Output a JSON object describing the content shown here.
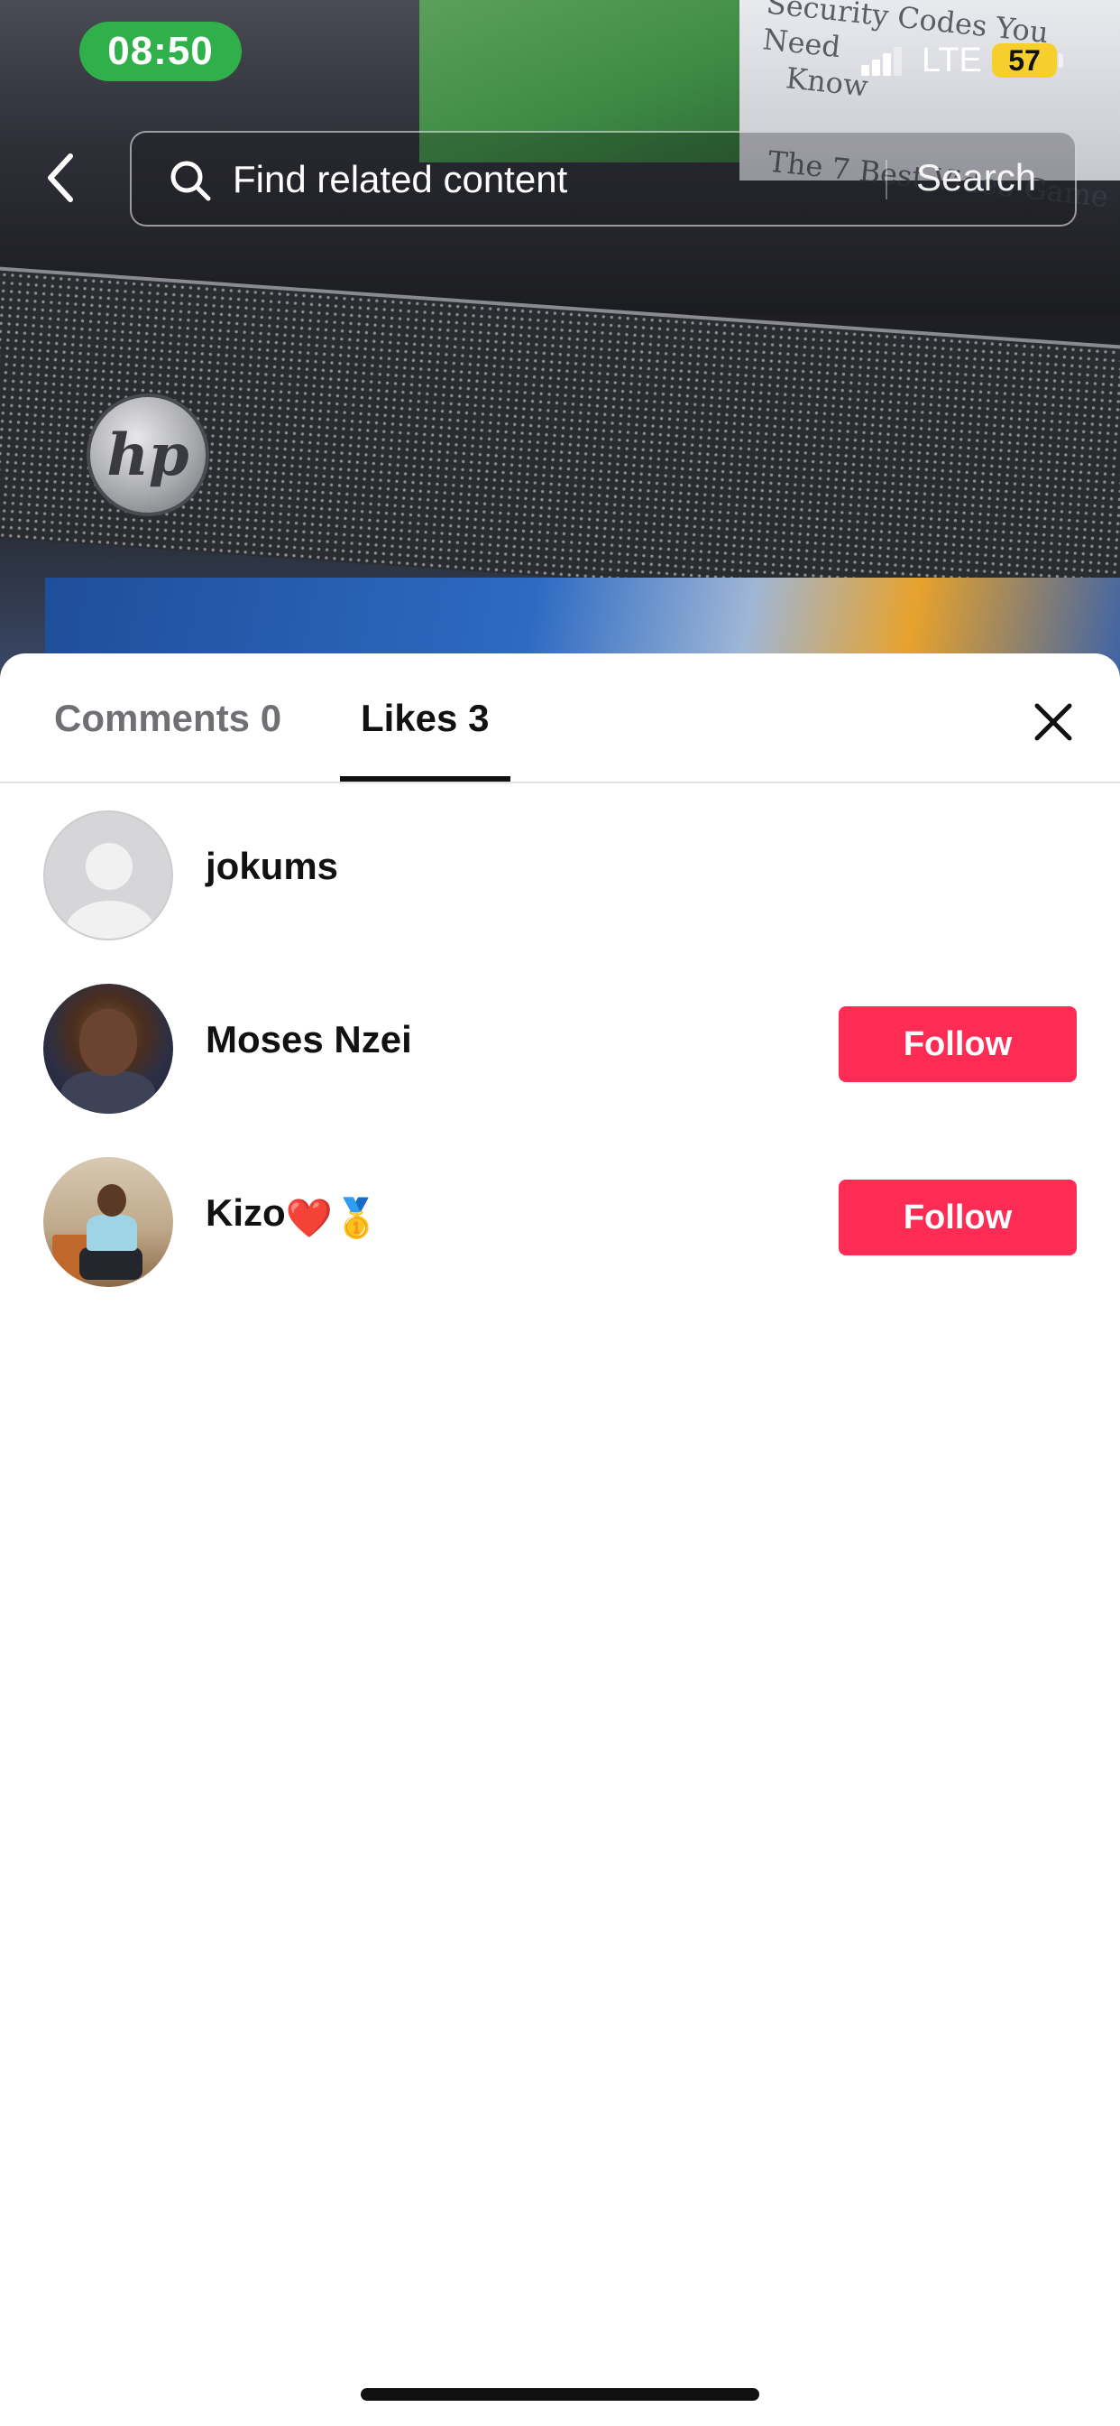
{
  "status_bar": {
    "time": "08:50",
    "network": "LTE",
    "battery": "57"
  },
  "video_screen_text": {
    "headline_line_1": "Security Codes You Need",
    "headline_line_2": "Know",
    "headline_line_3": "The 7 Best Video Game",
    "logo_text": "hp"
  },
  "search": {
    "placeholder": "Find related content",
    "button_label": "Search"
  },
  "tabs": [
    {
      "label": "Comments 0"
    },
    {
      "label": "Likes 3"
    }
  ],
  "active_tab": "Likes 3",
  "likes": [
    {
      "username": "jokums",
      "emojis": "",
      "follow_label": ""
    },
    {
      "username": "Moses Nzei",
      "emojis": "",
      "follow_label": "Follow"
    },
    {
      "username": "Kizo",
      "emojis": "❤️🥇",
      "follow_label": "Follow"
    }
  ],
  "colors": {
    "follow_button": "#fe2c55",
    "time_pill": "#30b04a",
    "battery": "#f7cf2d"
  },
  "icons": [
    "back-icon",
    "search-icon",
    "close-icon",
    "signal-icon"
  ]
}
